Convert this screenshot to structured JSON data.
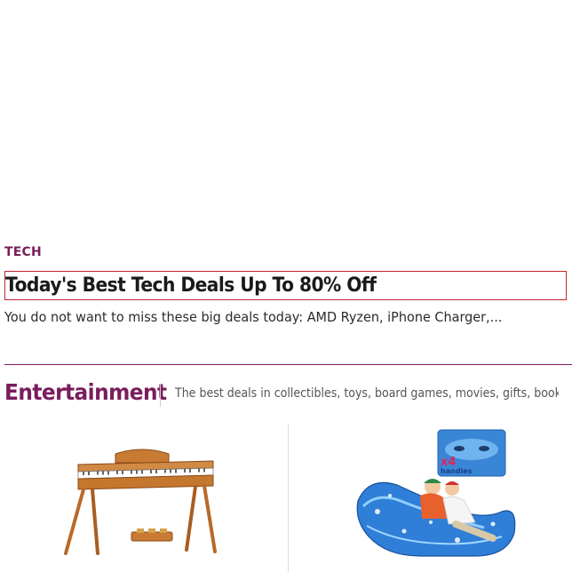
{
  "article": {
    "category": "TECH",
    "headline": "Today's Best Tech Deals Up To 80% Off",
    "dek": "You do not want to miss these big deals today: AMD Ryzen, iPhone Charger,..."
  },
  "section": {
    "title": "Entertainment",
    "description": "The best deals in collectibles, toys, board games, movies, gifts, books, and more"
  },
  "products": [
    {
      "name": "digital-piano-image",
      "icon": "piano"
    },
    {
      "name": "snow-sled-image",
      "icon": "sled",
      "badge_count": "x4",
      "badge_label": "handles"
    }
  ],
  "colors": {
    "accent": "#7a1d5c",
    "highlight_border": "#c0262d",
    "text": "#1a1a1a"
  }
}
